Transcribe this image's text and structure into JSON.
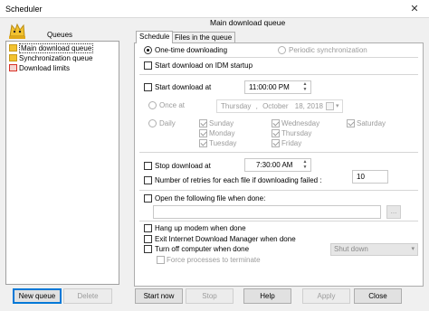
{
  "window": {
    "title": "Scheduler"
  },
  "sidebar": {
    "queues_label": "Queues",
    "items": [
      {
        "label": "Main download queue",
        "icon": "folder-icon",
        "color": "#f2c230"
      },
      {
        "label": "Synchronization queue",
        "icon": "folder-icon",
        "color": "#f2c230"
      },
      {
        "label": "Download limits",
        "icon": "limit-icon",
        "color": "#d93025"
      }
    ],
    "new_queue_label": "New queue",
    "delete_label": "Delete"
  },
  "panel": {
    "title": "Main download queue",
    "tabs": [
      "Schedule",
      "Files in the queue"
    ]
  },
  "schedule": {
    "one_time": "One-time downloading",
    "periodic": "Periodic synchronization",
    "start_on_startup": "Start download on IDM startup",
    "start_at": "Start download at",
    "start_time": "11:00:00 PM",
    "once_at": "Once at",
    "date_day": "Thursday",
    "date_month": "October",
    "date_rest": "18, 2018",
    "daily": "Daily",
    "days": [
      "Sunday",
      "Wednesday",
      "Saturday",
      "Monday",
      "Thursday",
      "Tuesday",
      "Friday"
    ],
    "stop_at": "Stop download at",
    "stop_time": "7:30:00 AM",
    "retries_label": "Number of retries for each file if downloading failed :",
    "retries_value": "10",
    "open_file": "Open the following file when done:",
    "browse": "...",
    "hang_up": "Hang up modem when done",
    "exit_idm": "Exit Internet Download Manager when done",
    "turn_off": "Turn off computer when done",
    "shutdown_option": "Shut down",
    "force": "Force processes to terminate"
  },
  "buttons": {
    "start_now": "Start now",
    "stop": "Stop",
    "help": "Help",
    "apply": "Apply",
    "close": "Close"
  }
}
